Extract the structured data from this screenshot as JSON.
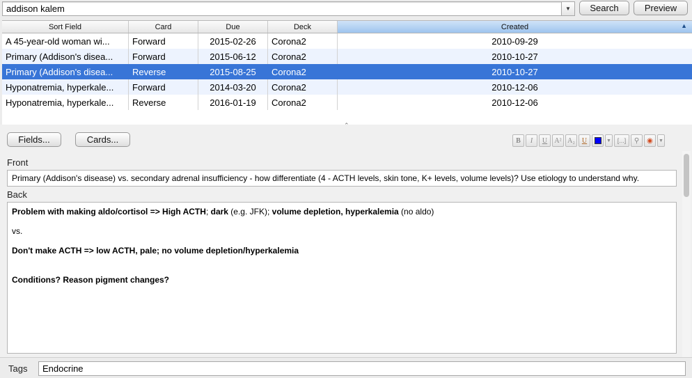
{
  "search": {
    "query": "addison kalem",
    "search_label": "Search",
    "preview_label": "Preview"
  },
  "table": {
    "columns": [
      "Sort Field",
      "Card",
      "Due",
      "Deck",
      "Created"
    ],
    "sorted_column": "Created",
    "sort_direction": "ascending",
    "rows": [
      {
        "sort_field": "A 45-year-old woman wi...",
        "card": "Forward",
        "due": "2015-02-26",
        "deck": "Corona2",
        "created": "2010-09-29"
      },
      {
        "sort_field": "Primary (Addison's disea...",
        "card": "Forward",
        "due": "2015-06-12",
        "deck": "Corona2",
        "created": "2010-10-27"
      },
      {
        "sort_field": "Primary (Addison's disea...",
        "card": "Reverse",
        "due": "2015-08-25",
        "deck": "Corona2",
        "created": "2010-10-27"
      },
      {
        "sort_field": "Hyponatremia, hyperkale...",
        "card": "Forward",
        "due": "2014-03-20",
        "deck": "Corona2",
        "created": "2010-12-06"
      },
      {
        "sort_field": "Hyponatremia, hyperkale...",
        "card": "Reverse",
        "due": "2016-01-19",
        "deck": "Corona2",
        "created": "2010-12-06"
      }
    ],
    "selected_row": 2
  },
  "editor": {
    "fields_label": "Fields...",
    "cards_label": "Cards...",
    "toolbar": {
      "bold": "B",
      "italic": "I",
      "underline": "U",
      "superscript": "A²",
      "subscript": "A₂",
      "clear_format": "U",
      "text_color": "#0000ff",
      "cloze": "[...]"
    },
    "front_label": "Front",
    "front_text": "Primary (Addison's disease) vs. secondary adrenal insufficiency - how differentiate (4 - ACTH levels, skin tone, K+ levels, volume levels)?  Use etiology to understand why.",
    "back_label": "Back",
    "back": {
      "line1_b1": "Problem with making aldo/cortisol => High ACTH",
      "line1_t1": "; ",
      "line1_b2": "dark",
      "line1_t2": " (e.g. JFK); ",
      "line1_b3": "volume depletion, hyperkalemia",
      "line1_t3": " (no aldo)",
      "line2": "vs.",
      "line3": "Don't make ACTH => low ACTH, pale; no volume depletion/hyperkalemia",
      "line4": "Conditions?  Reason pigment changes?"
    }
  },
  "tags": {
    "label": "Tags",
    "value": "Endocrine"
  },
  "colors": {
    "selection": "#3875d7",
    "alt_row": "#edf3fe",
    "sorted_header": "#9ec4ee"
  }
}
